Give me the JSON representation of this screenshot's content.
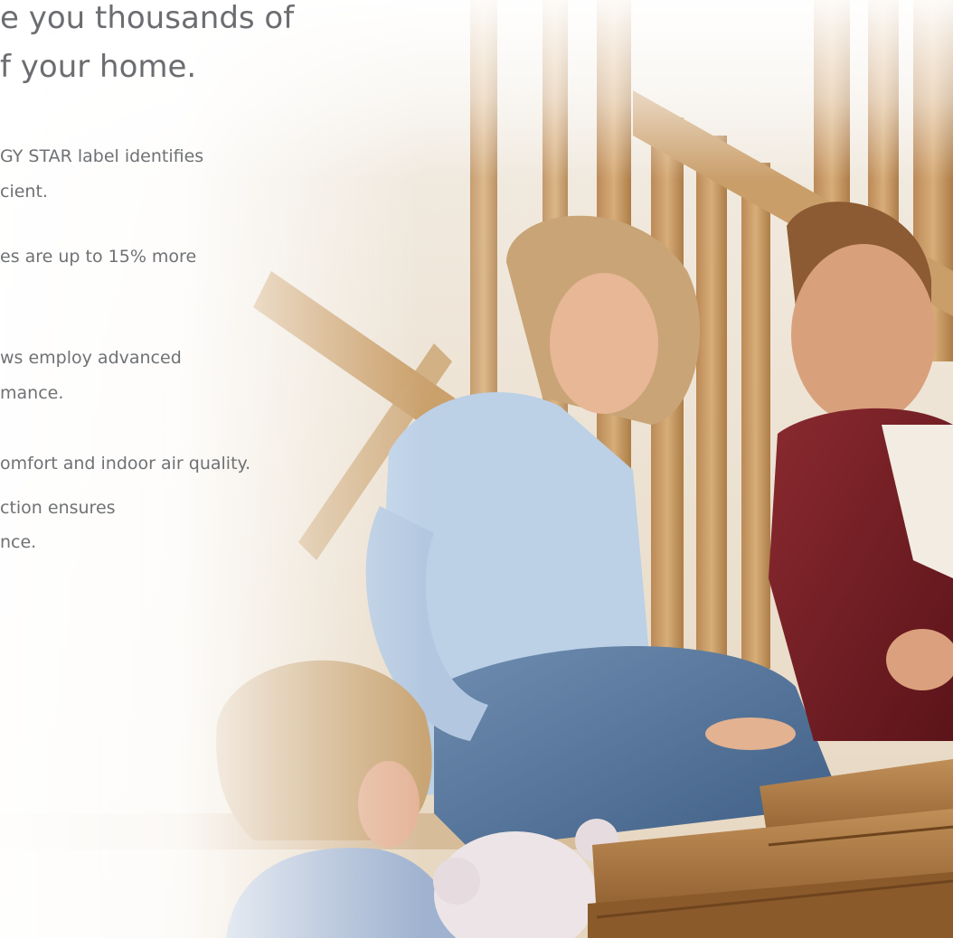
{
  "headline": {
    "line1": "e you thousands of",
    "line2": "f your home."
  },
  "bullets": [
    {
      "line1": "GY STAR label identifies",
      "line2": "cient."
    },
    {
      "line1": "es are up to 15% more",
      "line2": ""
    },
    {
      "line1": "ws employ advanced",
      "line2": "mance."
    },
    {
      "line1": "omfort and indoor air quality.",
      "line2": ""
    },
    {
      "line1": "ction ensures",
      "line2": "nce."
    }
  ],
  "colors": {
    "text": "#6b6d70",
    "wood": "#c79a63",
    "denim": "#5f7ea3",
    "shirt_blue": "#b9cde3",
    "shirt_red": "#7a1f25"
  }
}
